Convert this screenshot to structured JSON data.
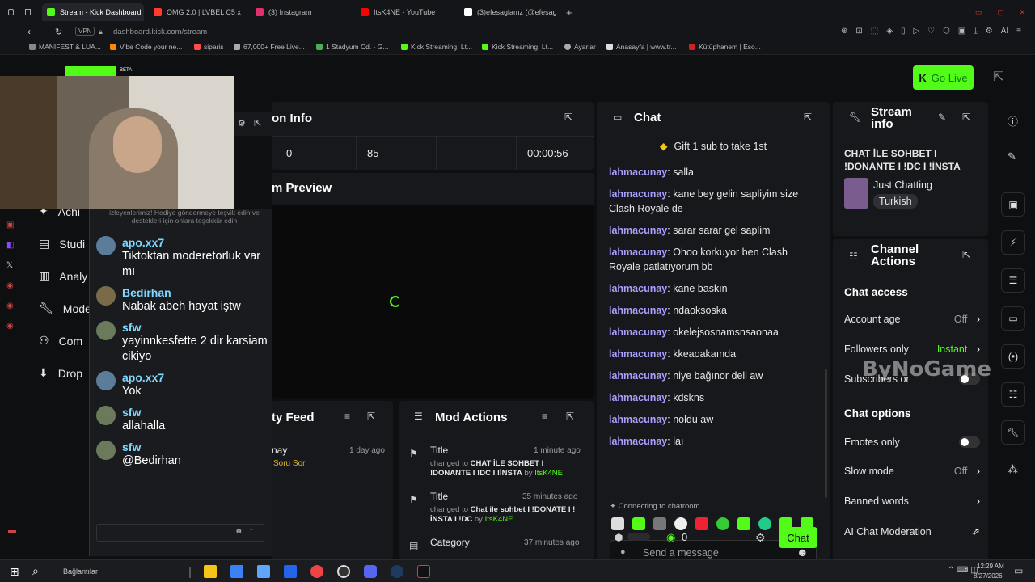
{
  "browser": {
    "tabs": [
      {
        "label": "Stream - Kick Dashboard",
        "color": "#53fc18"
      },
      {
        "label": "OMG 2.0 | LVBEL C5 x",
        "color": "#ff3b30"
      },
      {
        "label": "(3) Instagram",
        "color": "#e1306c"
      },
      {
        "label": "ItsK4NE - YouTube",
        "color": "#ff0000"
      },
      {
        "label": "(3)efesaglamz (@efesagla",
        "color": "#ffffff"
      }
    ],
    "url": "dashboard.kick.com/stream",
    "vpn": "VPN",
    "bookmarks": [
      {
        "label": "MANIFEST & LUA...",
        "color": "#888888"
      },
      {
        "label": "Vibe Code your ne...",
        "color": "#ff8a00"
      },
      {
        "label": "siparis",
        "color": "#ff4d4d"
      },
      {
        "label": "67,000+ Free Live...",
        "color": "#aaaaaa"
      },
      {
        "label": "1 Stadyum Cd. - G...",
        "color": "#4caf50"
      },
      {
        "label": "Kick Streaming, Lt...",
        "color": "#53fc18"
      },
      {
        "label": "Kick Streaming, Lt...",
        "color": "#53fc18"
      },
      {
        "label": "Ayarlar",
        "color": "#aaaaaa"
      },
      {
        "label": "Anasayfa | www.tr...",
        "color": "#dddddd"
      },
      {
        "label": "Kütüphanem | Eso...",
        "color": "#cc2222"
      }
    ]
  },
  "header": {
    "beta": "BETA",
    "go_live": "Go Live"
  },
  "left_nav": [
    "Achi",
    "Studi",
    "Analy",
    "Mode",
    "Com",
    "Drop"
  ],
  "session_info": {
    "title": "on Info",
    "stats": [
      "0",
      "85",
      "-",
      "00:00:56"
    ]
  },
  "stream_preview": {
    "title": "m Preview"
  },
  "activity_feed": {
    "title": "ty Feed",
    "items": [
      {
        "user": "nay",
        "time": "1 day ago",
        "action": "Soru Sor"
      }
    ]
  },
  "mod_actions": {
    "title": "Mod Actions",
    "items": [
      {
        "type": "Title",
        "time": "1 minute ago",
        "changed": "changed to",
        "value": "CHAT İLE SOHBET I !DONANTE I !DC I !İNSTA",
        "by": "by",
        "user": "ItsK4NE"
      },
      {
        "type": "Title",
        "time": "35 minutes ago",
        "changed": "changed to",
        "value": "Chat ile sohbet I !DONATE I !İNSTA I !DC",
        "by": "by",
        "user": "ItsK4NE"
      },
      {
        "type": "Category",
        "time": "37 minutes ago",
        "changed": "",
        "value": "",
        "by": "",
        "user": ""
      }
    ]
  },
  "chat": {
    "title": "Chat",
    "gift": "Gift 1 sub to take 1st",
    "messages": [
      {
        "user": "lahmacunay",
        "text": "salla"
      },
      {
        "user": "lahmacunay",
        "text": "kane bey gelin sapliyim size Clash Royale de"
      },
      {
        "user": "lahmacunay",
        "text": "sarar sarar gel saplim"
      },
      {
        "user": "lahmacunay",
        "text": "Ohoo korkuyor ben Clash Royale patlatıyorum bb"
      },
      {
        "user": "lahmacunay",
        "text": "kane baskın"
      },
      {
        "user": "lahmacunay",
        "text": "ndaoksoska"
      },
      {
        "user": "lahmacunay",
        "text": "okelejsosnamsnsaonaa"
      },
      {
        "user": "lahmacunay",
        "text": "kkeaoakaında"
      },
      {
        "user": "lahmacunay",
        "text": "niye bağınor deli aw"
      },
      {
        "user": "lahmacunay",
        "text": "kdskns"
      },
      {
        "user": "lahmacunay",
        "text": "noldu aw"
      },
      {
        "user": "lahmacunay",
        "text": "laı"
      }
    ],
    "connecting": "Connecting to chatroom...",
    "placeholder": "Send a message",
    "count": "0",
    "send": "Chat"
  },
  "stream_info": {
    "title": "Stream info",
    "stream_title": "CHAT İLE SOHBET I !DONANTE I !DC I !İNSTA",
    "category": "Just Chatting",
    "language": "Turkish"
  },
  "channel_actions": {
    "title": "Channel Actions",
    "chat_access": "Chat access",
    "account_age": "Account age",
    "account_age_val": "Off",
    "followers_only": "Followers only",
    "followers_only_val": "Instant",
    "subscribers": "Subscribers only",
    "chat_options": "Chat options",
    "emotes_only": "Emotes only",
    "slow_mode": "Slow mode",
    "slow_mode_val": "Off",
    "banned_words": "Banned words",
    "ai_mod": "AI Chat Moderation"
  },
  "watermark": "ByNoGame",
  "overlay_chat": {
    "top_text": "izleyenlerimiz! Hediye göndermeye teşvik edin ve destekleri için onlara teşekkür edin",
    "messages": [
      {
        "user": "apo.xx7",
        "text": "Tiktoktan moderetorluk var mı"
      },
      {
        "user": "Bedirhan",
        "text": "Nabak abeh hayat iştw"
      },
      {
        "user": "sfw",
        "text": "yayinnkesfette 2 dir karsiam cikiyo"
      },
      {
        "user": "apo.xx7",
        "text": "Yok"
      },
      {
        "user": "sfw",
        "text": "allahalla"
      },
      {
        "user": "sfw",
        "text": "@Bedirhan"
      }
    ]
  },
  "taskbar": {
    "search": "Bağlantılar",
    "time": "12:29 AM",
    "date": "8/27/2026"
  }
}
